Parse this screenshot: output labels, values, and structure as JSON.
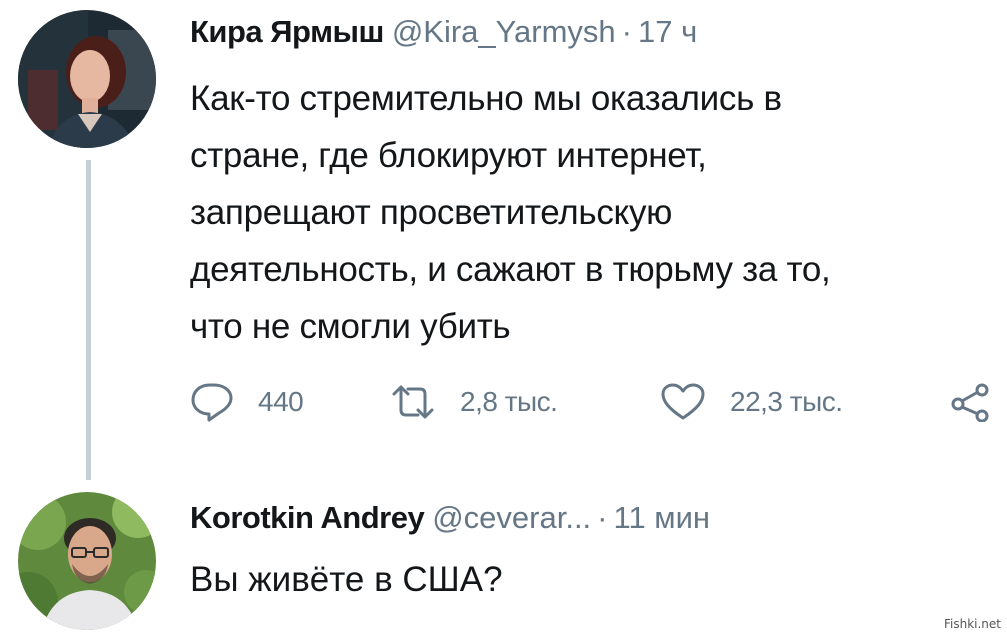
{
  "tweet": {
    "author_name": "Кира Ярмыш",
    "handle": "@Kira_Yarmysh",
    "separator": "·",
    "time": "17 ч",
    "text_lines": [
      "Как-то стремительно мы оказались в",
      "стране, где блокируют интернет,",
      "запрещают просветительскую",
      "деятельность, и сажают в тюрьму за то,",
      "что не смогли убить"
    ],
    "actions": {
      "reply_icon": "reply-icon",
      "reply_count": "440",
      "retweet_icon": "retweet-icon",
      "retweet_count": "2,8 тыс.",
      "like_icon": "heart-icon",
      "like_count": "22,3 тыс.",
      "share_icon": "share-icon"
    }
  },
  "reply": {
    "author_name": "Korotkin Andrey",
    "handle": "@ceverar...",
    "separator": "·",
    "time": "11 мин",
    "text": "Вы живёте в США?"
  },
  "watermark": "Fishki.net",
  "colors": {
    "text": "#14171a",
    "muted": "#657786",
    "thread_line": "#c4cfd6",
    "background": "#ffffff"
  }
}
